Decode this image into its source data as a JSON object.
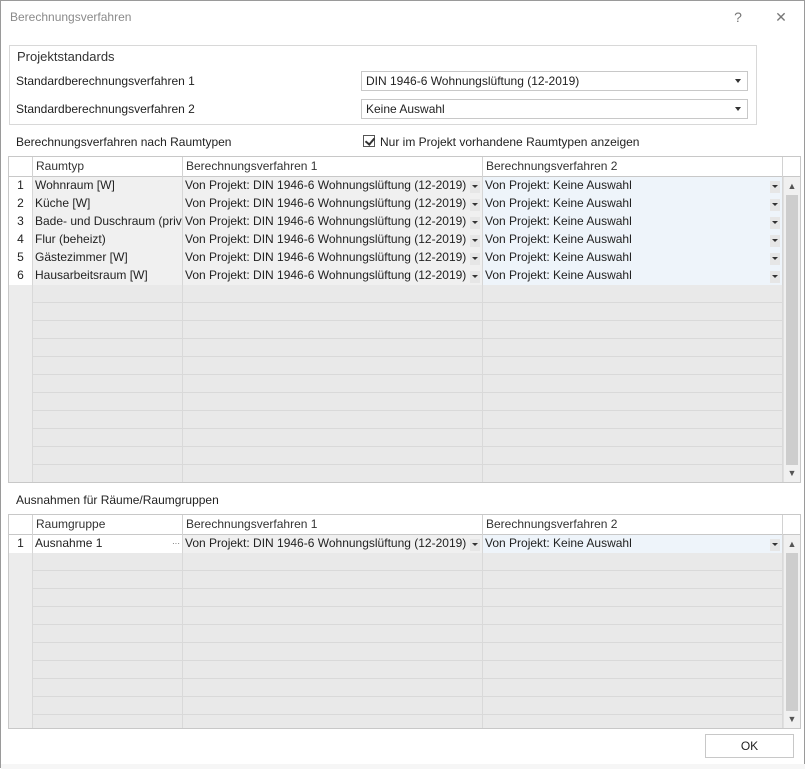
{
  "window": {
    "title": "Berechnungsverfahren",
    "help_label": "?",
    "close_label": "✕"
  },
  "project_standards": {
    "group_title": "Projektstandards",
    "label1": "Standardberechnungsverfahren 1",
    "value1": "DIN 1946-6 Wohnungslüftung (12-2019)",
    "label2": "Standardberechnungsverfahren 2",
    "value2": "Keine Auswahl"
  },
  "room_types": {
    "section_label": "Berechnungsverfahren nach Raumtypen",
    "checkbox_label": "Nur im Projekt vorhandene Raumtypen anzeigen",
    "checkbox_checked": true,
    "columns": [
      "Raumtyp",
      "Berechnungsverfahren 1",
      "Berechnungsverfahren 2"
    ],
    "rows": [
      {
        "num": "1",
        "name": "Wohnraum [W]",
        "v1": "Von Projekt: DIN 1946-6 Wohnungslüftung (12-2019)",
        "v2": "Von Projekt: Keine Auswahl"
      },
      {
        "num": "2",
        "name": "Küche [W]",
        "v1": "Von Projekt: DIN 1946-6 Wohnungslüftung (12-2019)",
        "v2": "Von Projekt: Keine Auswahl"
      },
      {
        "num": "3",
        "name": "Bade- und Duschraum (priva...",
        "v1": "Von Projekt: DIN 1946-6 Wohnungslüftung (12-2019)",
        "v2": "Von Projekt: Keine Auswahl"
      },
      {
        "num": "4",
        "name": "Flur (beheizt)",
        "v1": "Von Projekt: DIN 1946-6 Wohnungslüftung (12-2019)",
        "v2": "Von Projekt: Keine Auswahl"
      },
      {
        "num": "5",
        "name": "Gästezimmer [W]",
        "v1": "Von Projekt: DIN 1946-6 Wohnungslüftung (12-2019)",
        "v2": "Von Projekt: Keine Auswahl"
      },
      {
        "num": "6",
        "name": "Hausarbeitsraum [W]",
        "v1": "Von Projekt: DIN 1946-6 Wohnungslüftung (12-2019)",
        "v2": "Von Projekt: Keine Auswahl"
      }
    ]
  },
  "exceptions": {
    "section_label": "Ausnahmen für Räume/Raumgruppen",
    "columns": [
      "Raumgruppe",
      "Berechnungsverfahren 1",
      "Berechnungsverfahren 2"
    ],
    "rows": [
      {
        "num": "1",
        "name": "Ausnahme 1",
        "v1": "Von Projekt: DIN 1946-6 Wohnungslüftung (12-2019)",
        "v2": "Von Projekt: Keine Auswahl"
      }
    ]
  },
  "footer": {
    "ok_label": "OK"
  }
}
